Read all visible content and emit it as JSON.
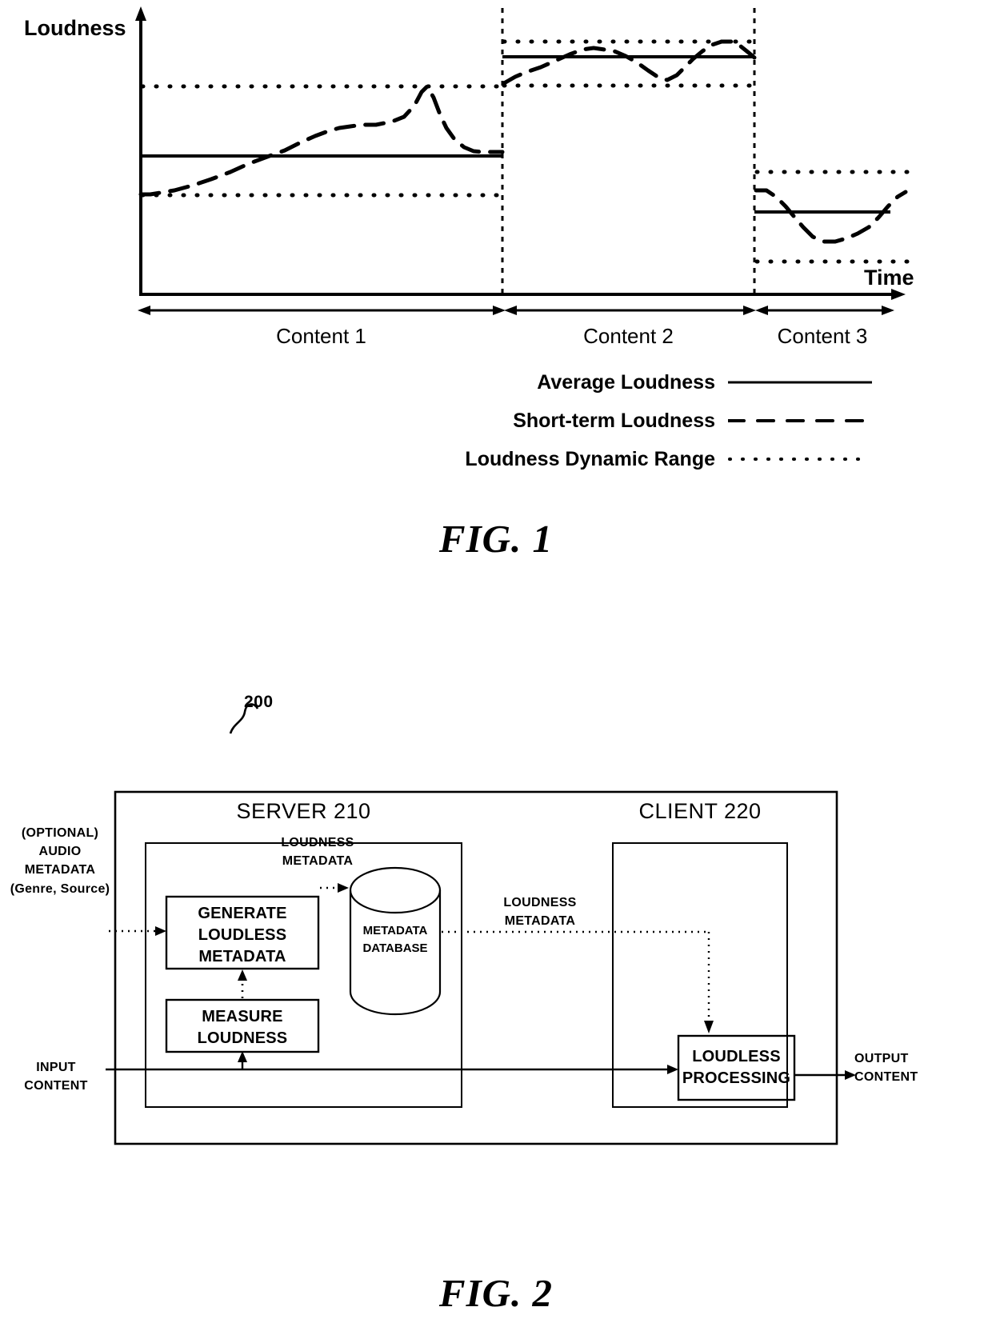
{
  "figure1": {
    "caption": "FIG. 1",
    "y_axis_label": "Loudness",
    "x_axis_label": "Time",
    "segment_labels": [
      "Content 1",
      "Content 2",
      "Content 3"
    ],
    "legend": [
      {
        "label": "Average Loudness",
        "style": "solid"
      },
      {
        "label": "Short-term Loudness",
        "style": "dashed"
      },
      {
        "label": "Loudness Dynamic Range",
        "style": "dotted"
      }
    ]
  },
  "chart_data": {
    "type": "line",
    "title": "",
    "xlabel": "Time",
    "ylabel": "Loudness",
    "grid": false,
    "legend_position": "below",
    "axis_ranges": {
      "x": [
        0,
        100
      ],
      "y": [
        0,
        100
      ]
    },
    "segments": [
      {
        "name": "Content 1",
        "x_range": [
          0,
          48.5
        ],
        "average_loudness": 52,
        "dynamic_range": [
          38,
          76
        ],
        "short_term_loudness": {
          "x": [
            0.5,
            2.5,
            5,
            8,
            12,
            16,
            20,
            24,
            28,
            31,
            34,
            36.5,
            38,
            39.2,
            40.5,
            42,
            44,
            46,
            48
          ],
          "y": [
            38,
            38,
            39.5,
            41,
            44,
            47.5,
            51,
            54,
            57,
            59,
            60.5,
            64,
            72,
            80,
            74,
            64,
            56,
            54,
            54
          ]
        }
      },
      {
        "name": "Content 2",
        "x_range": [
          48.5,
          82.5
        ],
        "average_loudness": 86,
        "dynamic_range": [
          80,
          91
        ],
        "short_term_loudness": {
          "x": [
            49,
            51,
            53,
            56,
            59,
            62,
            64,
            66,
            68,
            70,
            72,
            74,
            76,
            78,
            80,
            82
          ],
          "y": [
            80.5,
            82,
            84,
            86.5,
            88,
            89,
            88.5,
            86.5,
            85,
            82.5,
            81,
            82,
            85,
            88.5,
            90,
            87
          ]
        }
      },
      {
        "name": "Content 3",
        "x_range": [
          82.5,
          100
        ],
        "average_loudness": 25,
        "dynamic_range": [
          13,
          32
        ],
        "short_term_loudness": {
          "x": [
            83,
            84.5,
            86,
            87.5,
            89,
            91,
            93,
            95,
            97,
            99
          ],
          "y": [
            31,
            29,
            27,
            24,
            20,
            16.5,
            15,
            16.5,
            20,
            27
          ]
        }
      }
    ]
  },
  "figure2": {
    "caption": "FIG. 2",
    "system_ref": "200",
    "server": {
      "title": "SERVER 210",
      "blocks": [
        {
          "id": "generate",
          "label": "GENERATE\nLOUDLESS\nMETADATA"
        },
        {
          "id": "measure",
          "label": "MEASURE\nLOUDNESS"
        }
      ],
      "database": {
        "label": "METADATA\nDATABASE"
      }
    },
    "client": {
      "title": "CLIENT 220",
      "blocks": [
        {
          "id": "processing",
          "label": "LOUDLESS\nPROCESSING"
        }
      ]
    },
    "flow_labels": {
      "optional_audio_metadata": "(OPTIONAL)\nAUDIO\nMETADATA\n(Genre, Source)",
      "loudness_metadata_server": "LOUDNESS\nMETADATA",
      "loudness_metadata_link": "LOUDNESS\nMETADATA",
      "input_content": "INPUT\nCONTENT",
      "output_content": "OUTPUT\nCONTENT"
    }
  },
  "colors": {
    "ink": "#000000",
    "paper": "#ffffff"
  }
}
